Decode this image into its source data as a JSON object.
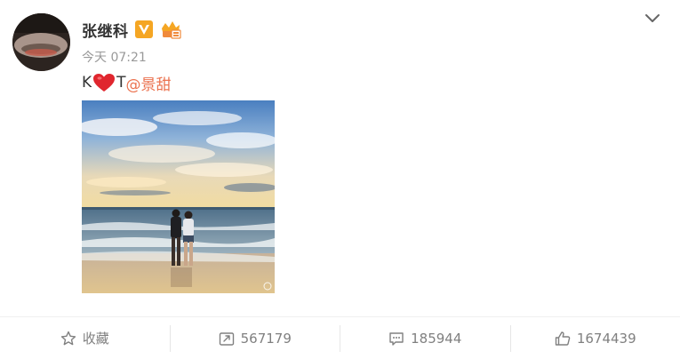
{
  "post": {
    "username": "张继科",
    "time": "今天 07:21",
    "text_before": "K",
    "text_middle": "T",
    "mention": "@景甜"
  },
  "actions": {
    "favorite_label": "收藏",
    "repost_count": "567179",
    "comment_count": "185944",
    "like_count": "1674439"
  },
  "icons": {
    "verified": "verified-v-icon",
    "vip": "vip-crown-icon",
    "heart": "heart-icon",
    "dropdown": "chevron-down-icon",
    "favorite": "star-icon",
    "repost": "repost-icon",
    "comment": "comment-icon",
    "like": "thumbs-up-icon"
  },
  "colors": {
    "verified_orange": "#f5a623",
    "mention": "#eb7350",
    "heart_red": "#e0262e",
    "muted_text": "#808080"
  }
}
